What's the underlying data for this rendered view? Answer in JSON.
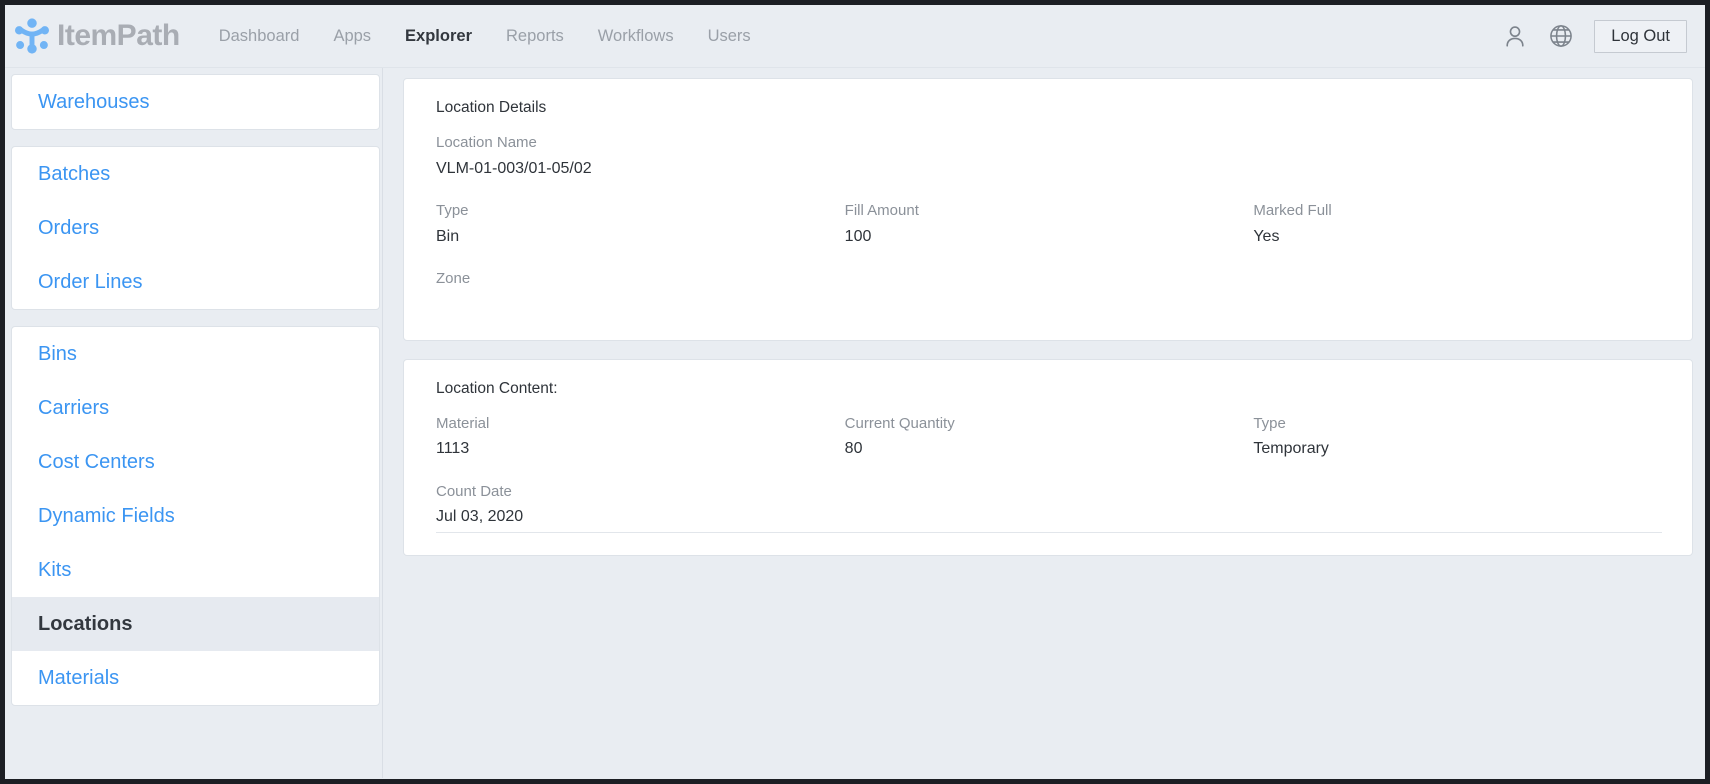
{
  "header": {
    "logo_text": "ItemPath",
    "logo_icon": "molecule-nodes-icon",
    "nav": [
      {
        "label": "Dashboard",
        "active": false
      },
      {
        "label": "Apps",
        "active": false
      },
      {
        "label": "Explorer",
        "active": true
      },
      {
        "label": "Reports",
        "active": false
      },
      {
        "label": "Workflows",
        "active": false
      },
      {
        "label": "Users",
        "active": false
      }
    ],
    "user_icon": "user-icon",
    "language_icon": "globe-icon",
    "logout_label": "Log Out"
  },
  "sidebar": {
    "groups": [
      {
        "items": [
          {
            "label": "Warehouses",
            "active": false
          }
        ]
      },
      {
        "items": [
          {
            "label": "Batches",
            "active": false
          },
          {
            "label": "Orders",
            "active": false
          },
          {
            "label": "Order Lines",
            "active": false
          }
        ]
      },
      {
        "items": [
          {
            "label": "Bins",
            "active": false
          },
          {
            "label": "Carriers",
            "active": false
          },
          {
            "label": "Cost Centers",
            "active": false
          },
          {
            "label": "Dynamic Fields",
            "active": false
          },
          {
            "label": "Kits",
            "active": false
          },
          {
            "label": "Locations",
            "active": true
          },
          {
            "label": "Materials",
            "active": false
          }
        ]
      }
    ]
  },
  "main": {
    "details_card": {
      "title": "Location Details",
      "rows": [
        [
          {
            "label": "Location Name",
            "value": "VLM-01-003/01-05/02",
            "full": true
          }
        ],
        [
          {
            "label": "Type",
            "value": "Bin"
          },
          {
            "label": "Fill Amount",
            "value": "100"
          },
          {
            "label": "Marked Full",
            "value": "Yes"
          }
        ],
        [
          {
            "label": "Zone",
            "value": "",
            "full": true
          }
        ]
      ]
    },
    "content_card": {
      "title": "Location Content:",
      "rows": [
        [
          {
            "label": "Material",
            "value": "1113"
          },
          {
            "label": "Current Quantity",
            "value": "80"
          },
          {
            "label": "Type",
            "value": "Temporary"
          }
        ],
        [
          {
            "label": "Count Date",
            "value": "Jul 03, 2020",
            "full": true
          }
        ]
      ],
      "has_divider": true
    }
  },
  "colors": {
    "page_background": "#e9edf2",
    "card_background": "#ffffff",
    "link_blue": "#3b95f2",
    "logo_gray": "#a9adb4",
    "text_dark": "#2f343a",
    "label_gray": "#8b9199",
    "frame_border": "#1c1f24"
  }
}
